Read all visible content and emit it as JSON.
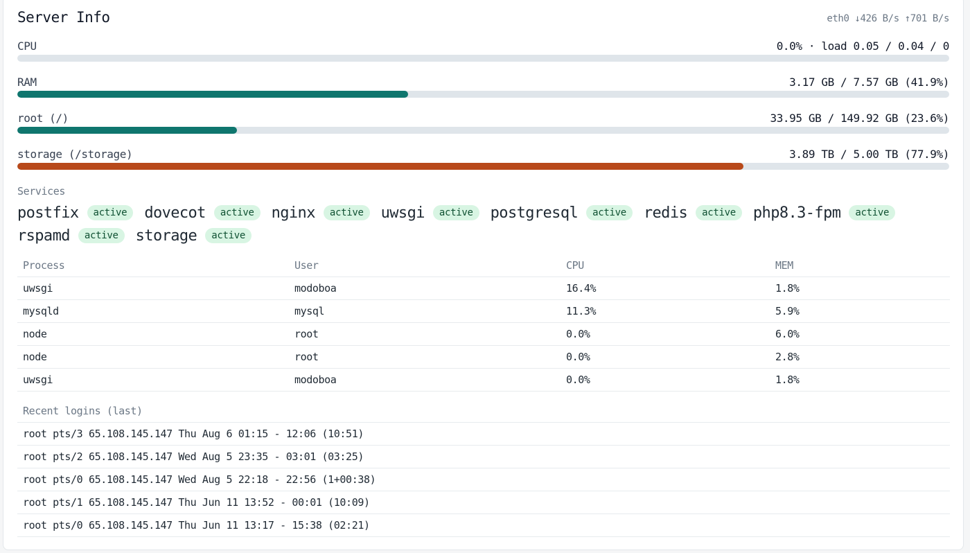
{
  "header": {
    "title": "Server Info",
    "net": "eth0 ↓426 B/s ↑701 B/s"
  },
  "meters": [
    {
      "label": "CPU",
      "value": "0.0% · load 0.05 / 0.04 / 0",
      "percent": 0.0,
      "color": "#0f766e"
    },
    {
      "label": "RAM",
      "value": "3.17 GB / 7.57 GB (41.9%)",
      "percent": 41.9,
      "color": "#0f766e"
    },
    {
      "label": "root (/)",
      "value": "33.95 GB / 149.92 GB (23.6%)",
      "percent": 23.6,
      "color": "#0f766e"
    },
    {
      "label": "storage (/storage)",
      "value": "3.89 TB / 5.00 TB (77.9%)",
      "percent": 77.9,
      "color": "#b8491a"
    }
  ],
  "services": {
    "label": "Services",
    "items": [
      {
        "name": "postfix",
        "status": "active"
      },
      {
        "name": "dovecot",
        "status": "active"
      },
      {
        "name": "nginx",
        "status": "active"
      },
      {
        "name": "uwsgi",
        "status": "active"
      },
      {
        "name": "postgresql",
        "status": "active"
      },
      {
        "name": "redis",
        "status": "active"
      },
      {
        "name": "php8.3-fpm",
        "status": "active"
      },
      {
        "name": "rspamd",
        "status": "active"
      },
      {
        "name": "storage",
        "status": "active"
      }
    ]
  },
  "processes": {
    "headers": [
      "Process",
      "User",
      "CPU",
      "MEM"
    ],
    "rows": [
      [
        "uwsgi",
        "modoboa",
        "16.4%",
        "1.8%"
      ],
      [
        "mysqld",
        "mysql",
        "11.3%",
        "5.9%"
      ],
      [
        "node",
        "root",
        "0.0%",
        "6.0%"
      ],
      [
        "node",
        "root",
        "0.0%",
        "2.8%"
      ],
      [
        "uwsgi",
        "modoboa",
        "0.0%",
        "1.8%"
      ]
    ]
  },
  "logins": {
    "header": "Recent logins (last)",
    "rows": [
      "root pts/3 65.108.145.147 Thu Aug 6 01:15 - 12:06 (10:51)",
      "root pts/2 65.108.145.147 Wed Aug 5 23:35 - 03:01 (03:25)",
      "root pts/0 65.108.145.147 Wed Aug 5 22:18 - 22:56 (1+00:38)",
      "root pts/1 65.108.145.147 Thu Jun 11 13:52 - 00:01 (10:09)",
      "root pts/0 65.108.145.147 Thu Jun 11 13:17 - 15:38 (02:21)"
    ]
  }
}
